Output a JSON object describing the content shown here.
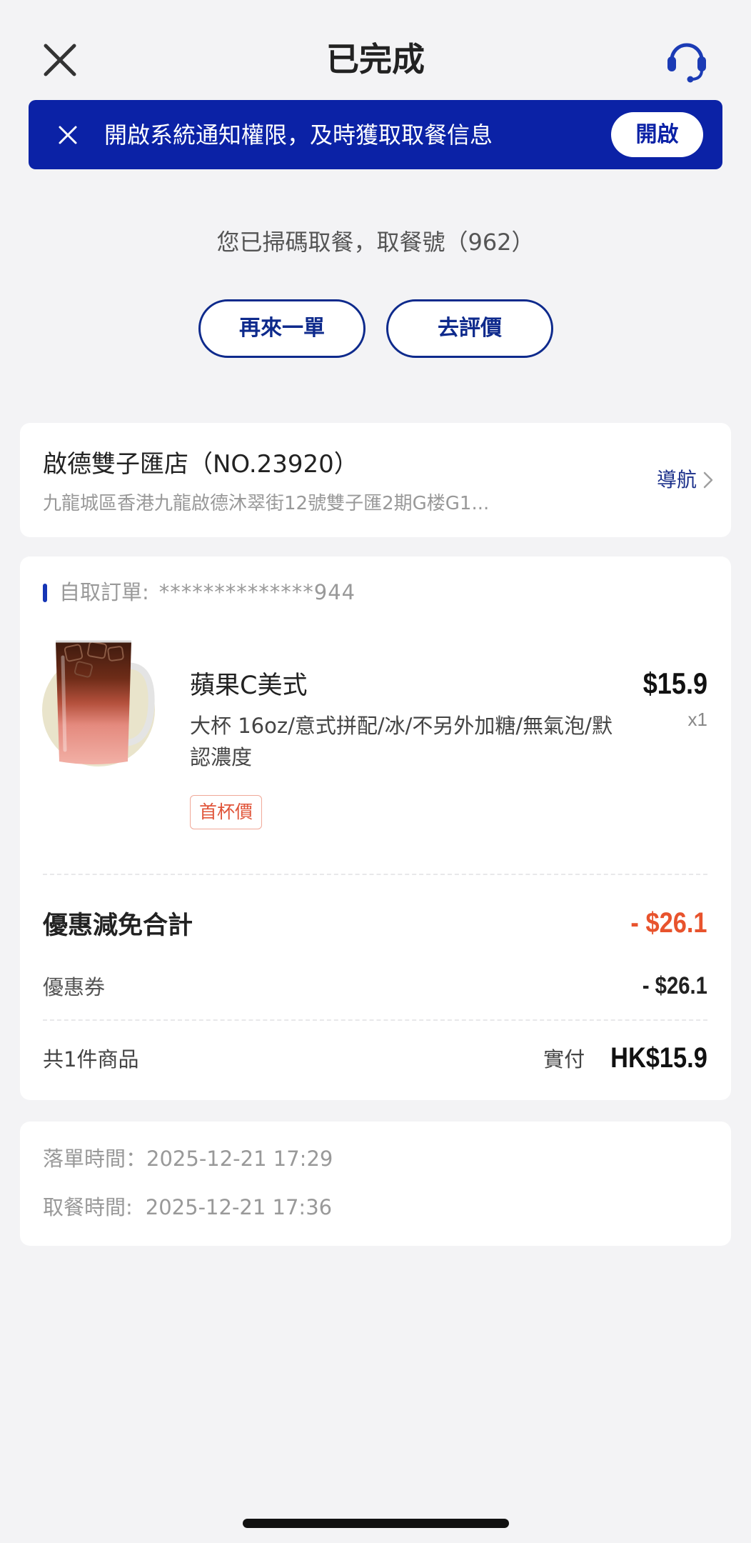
{
  "header": {
    "title": "已完成",
    "close_icon": "close-icon",
    "support_icon": "headset-icon"
  },
  "banner": {
    "text": "開啟系統通知權限，及時獲取取餐信息",
    "button_label": "開啟",
    "dismiss_icon": "close-icon"
  },
  "status": {
    "message": "您已掃碼取餐，取餐號（962）"
  },
  "actions": {
    "reorder_label": "再來一單",
    "review_label": "去評價"
  },
  "store": {
    "name": "啟德雙子匯店（NO.23920）",
    "address": "九龍城區香港九龍啟德沐翠街12號雙子匯2期G楼G1...",
    "nav_label": "導航",
    "nav_icon": "chevron-right-icon"
  },
  "order": {
    "type_label": "自取訂單:",
    "order_no": "**************944",
    "items": [
      {
        "name": "蘋果C美式",
        "specs": "大杯 16oz/意式拼配/冰/不另外加糖/無氣泡/默認濃度",
        "badge": "首杯價",
        "price": "$15.9",
        "qty": "x1",
        "image_icon": "iced-drink-image"
      }
    ],
    "discount_total_label": "優惠減免合計",
    "discount_total": "- $26.1",
    "coupon_label": "優惠券",
    "coupon_value": "- $26.1",
    "count_label": "共1件商品",
    "paid_label": "實付",
    "paid_value": "HK$15.9"
  },
  "times": {
    "order_time_label": "落單時間：",
    "order_time": "2025-12-21 17:29",
    "pickup_time_label": "取餐時間:",
    "pickup_time": "2025-12-21 17:36"
  },
  "colors": {
    "brand_blue": "#0b22a6",
    "button_border": "#0e2a8c",
    "discount_red": "#e8532d",
    "background": "#f3f3f5"
  }
}
